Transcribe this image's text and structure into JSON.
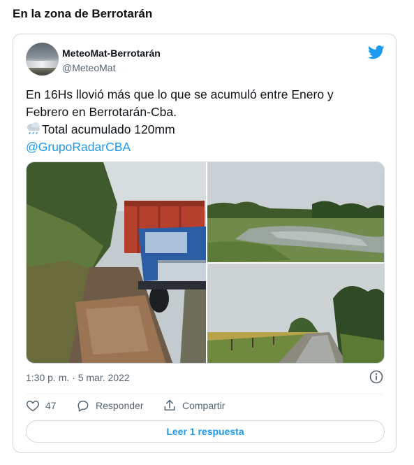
{
  "page": {
    "heading": "En la zona de Berrotarán"
  },
  "tweet": {
    "author": {
      "name": "MeteoMat-Berrotarán",
      "handle": "@MeteoMat"
    },
    "text_lines": [
      "En 16Hs llovió más que lo que se acumuló entre Enero y",
      "Febrero en Berrotarán-Cba.",
      "Total acumulado 120mm"
    ],
    "emoji": "cloud-with-rain-icon",
    "mention": "@GrupoRadarCBA",
    "timestamp": "1:30 p. m. · 5 mar. 2022",
    "likes": "47",
    "reply_label": "Responder",
    "share_label": "Compartir",
    "read_replies_label": "Leer 1 respuesta",
    "photos": [
      "photo-truck-flooded-road",
      "photo-flooded-field",
      "photo-flooded-rural-road"
    ],
    "colors": {
      "link": "#1d9bf0",
      "muted": "#536471",
      "border": "#cfd9de",
      "like": "#536471"
    }
  }
}
